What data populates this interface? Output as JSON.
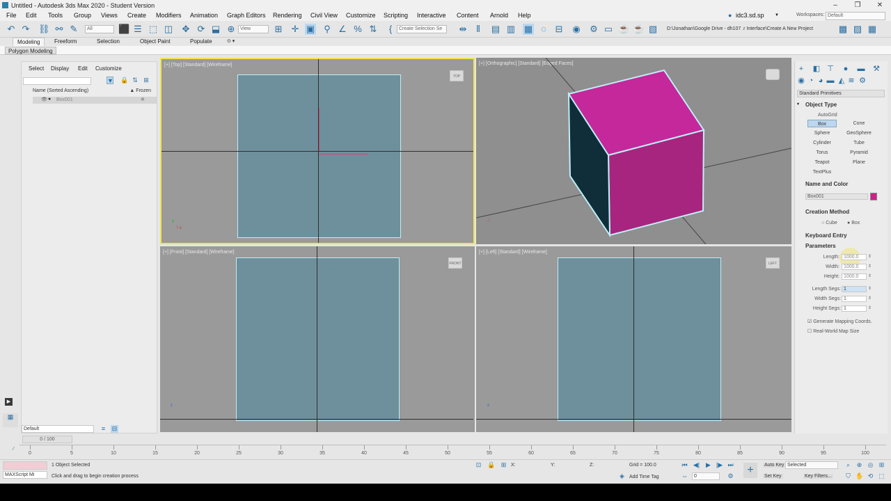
{
  "window": {
    "title": "Untitled - Autodesk 3ds Max 2020 - Student Version",
    "controls": [
      "–",
      "❐",
      "✕"
    ]
  },
  "menu": {
    "items": [
      "File",
      "Edit",
      "Tools",
      "Group",
      "Views",
      "Create",
      "Modifiers",
      "Animation",
      "Graph Editors",
      "Rendering",
      "Civil View",
      "Customize",
      "Scripting",
      "Interactive",
      "Content",
      "Arnold",
      "Help"
    ],
    "user": "idc3.sd.sp",
    "workspaces_label": "Workspaces:",
    "workspaces_value": "Default"
  },
  "toolbar": {
    "filter_value": "All",
    "view_value": "View",
    "selection_set_placeholder": "Create Selection Se",
    "project_path": "D:\\Jonathan\\Google Drive - dh107 .r Interface\\Create A New Project"
  },
  "ribbon": {
    "tabs": [
      "Modeling",
      "Freeform",
      "Selection",
      "Object Paint",
      "Populate"
    ],
    "sub": "Polygon Modeling"
  },
  "scene_explorer": {
    "menu": [
      "Select",
      "Display",
      "Edit",
      "Customize"
    ],
    "col_name": "Name (Sorted Ascending)",
    "col_frozen": "▲ Frozen",
    "rows": [
      "Box001"
    ],
    "layer": "Default"
  },
  "viewports": {
    "top": {
      "label": "[+] [Top] [Standard] [Wireframe]",
      "cube": "TOP"
    },
    "persp": {
      "label": "[+] [Orthographic] [Standard] [Edged Faces]"
    },
    "front": {
      "label": "[+] [Front] [Standard] [Wireframe]",
      "cube": "FRONT"
    },
    "left": {
      "label": "[+] [Left] [Standard] [Wireframe]",
      "cube": "LEFT"
    }
  },
  "command_panel": {
    "category": "Standard Primitives",
    "object_type": "Object Type",
    "autogrid": "AutoGrid",
    "buttons": [
      "Box",
      "Cone",
      "Sphere",
      "GeoSphere",
      "Cylinder",
      "Tube",
      "Torus",
      "Pyramid",
      "Teapot",
      "Plane",
      "TextPlus"
    ],
    "name_and_color": "Name and Color",
    "object_name": "Box001",
    "object_color": "#d21f8c",
    "creation_method": "Creation Method",
    "cube_label": "Cube",
    "box_label": "Box",
    "keyboard_entry": "Keyboard Entry",
    "parameters": "Parameters",
    "length_label": "Length:",
    "length_value": "1000.0",
    "width_label": "Width:",
    "width_value": "1000.0",
    "height_label": "Height:",
    "height_value": "1000.0",
    "length_segs_label": "Length Segs:",
    "length_segs": "1",
    "width_segs_label": "Width Segs:",
    "width_segs": "1",
    "height_segs_label": "Height Segs:",
    "height_segs": "1",
    "gen_mapping": "Generate Mapping Coords.",
    "real_world": "Real-World Map Size"
  },
  "timeline": {
    "frame": "0 / 100",
    "ticks": [
      0,
      5,
      10,
      15,
      20,
      25,
      30,
      35,
      40,
      45,
      50,
      55,
      60,
      65,
      70,
      75,
      80,
      85,
      90,
      95,
      100
    ]
  },
  "status": {
    "maxscript": "MAXScript Mi",
    "selected": "1 Object Selected",
    "prompt": "Click and drag to begin creation process",
    "x_label": "X:",
    "y_label": "Y:",
    "z_label": "Z:",
    "grid": "Grid = 100.0",
    "add_time_tag": "Add Time Tag",
    "auto_key": "Auto Key",
    "selected_dropdown": "Selected",
    "set_key": "Set Key",
    "key_filters": "Key Filters...",
    "frame_field": "0"
  },
  "colors": {
    "box_face_top": "#c4289b",
    "box_face_front": "#a8257f",
    "box_face_side": "#0f2e3a",
    "viewport_bg": "#9a9a9a",
    "active_border": "#f2e44e"
  }
}
